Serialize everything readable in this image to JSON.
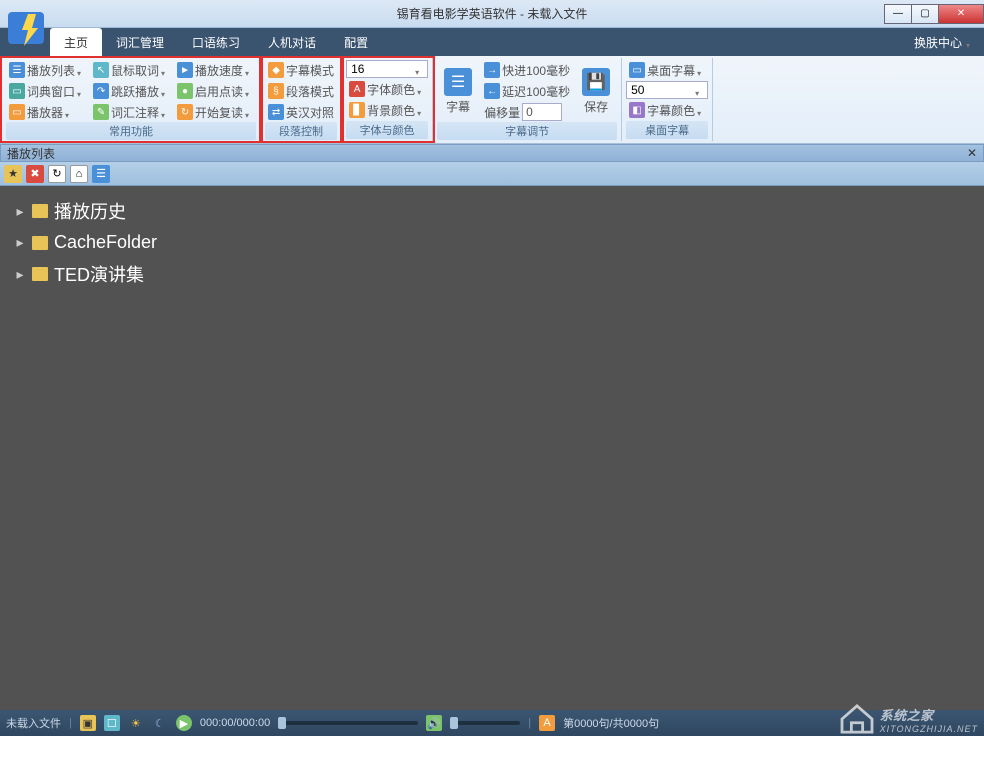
{
  "window": {
    "title": "锡育看电影学英语软件 - 未载入文件"
  },
  "menubar": {
    "tabs": [
      "主页",
      "词汇管理",
      "口语练习",
      "人机对话",
      "配置"
    ],
    "active": 0,
    "skin": "换肤中心"
  },
  "ribbon": {
    "group_common": {
      "label": "常用功能",
      "c1": [
        "播放列表",
        "词典窗口",
        "播放器"
      ],
      "c2": [
        "鼠标取词",
        "跳跃播放",
        "词汇注释"
      ],
      "c3": [
        "播放速度",
        "启用点读",
        "开始复读"
      ]
    },
    "group_para": {
      "label": "段落控制",
      "items": [
        "字幕模式",
        "段落模式",
        "英汉对照"
      ]
    },
    "group_font": {
      "label": "字体与颜色",
      "font_size": "16",
      "items": [
        "字体颜色",
        "背景颜色"
      ]
    },
    "group_sub_adj": {
      "label": "字幕调节",
      "btn": "字幕",
      "fast": "快进100毫秒",
      "slow": "延迟100毫秒",
      "offset_label": "偏移量",
      "offset_value": "0",
      "save": "保存"
    },
    "group_desktop": {
      "label": "桌面字幕",
      "btn": "桌面字幕",
      "value": "50",
      "color": "字幕颜色"
    }
  },
  "panel": {
    "title": "播放列表"
  },
  "tree": {
    "items": [
      "播放历史",
      "CacheFolder",
      "TED演讲集"
    ]
  },
  "statusbar": {
    "left": "未载入文件",
    "time": "000:00/000:00",
    "sentence": "第0000句/共0000句",
    "watermark_text": "系统之家",
    "watermark_url": "XITONGZHIJIA.NET"
  }
}
